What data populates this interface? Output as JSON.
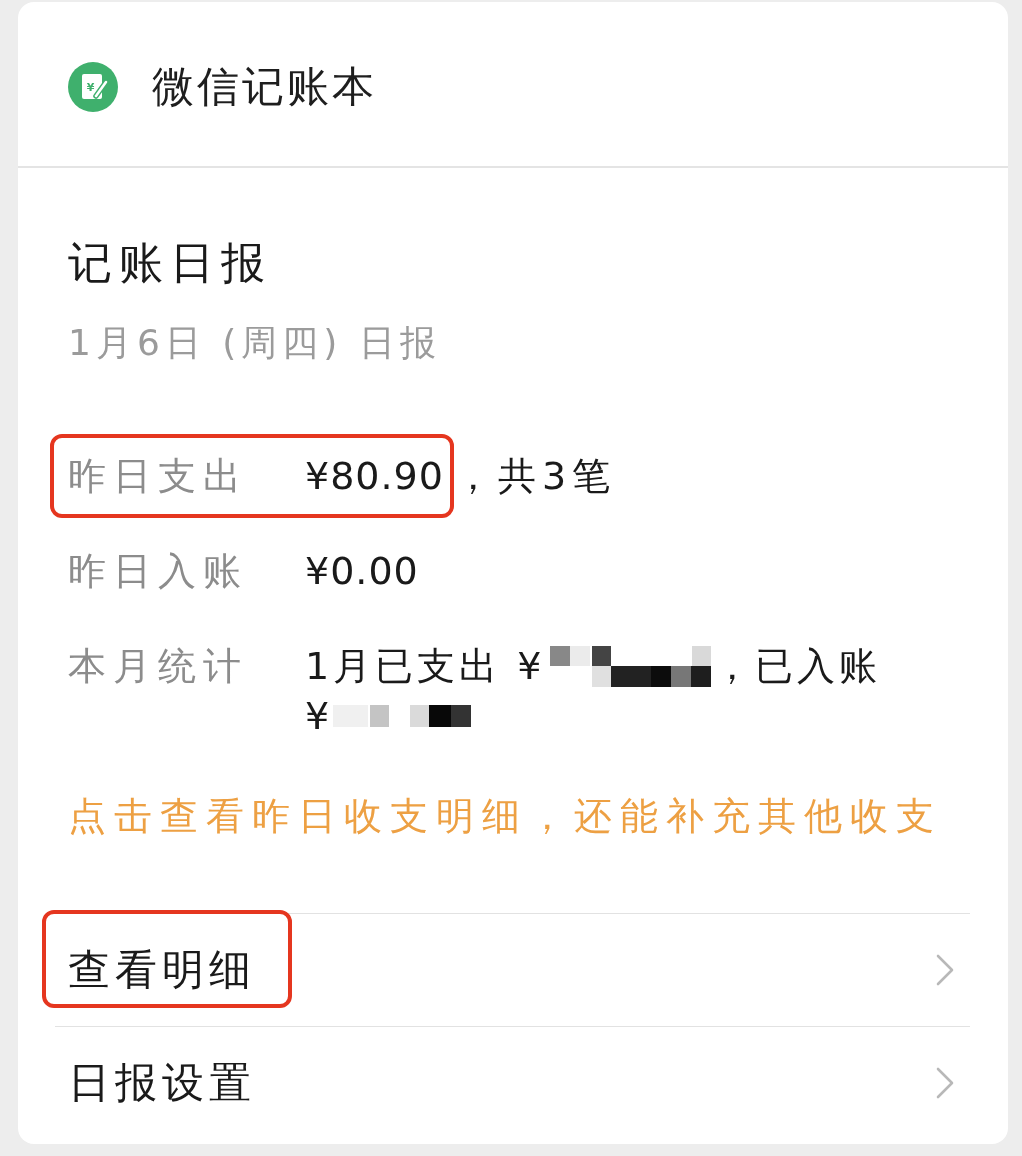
{
  "header": {
    "logo_glyph": "¥",
    "title": "微信记账本"
  },
  "report": {
    "title": "记账日报",
    "subtitle": "1月6日 (周四) 日报",
    "stats": [
      {
        "kind": "amount",
        "label": "昨日支出",
        "value": "¥80.90",
        "note": "，共3笔",
        "highlighted": true
      },
      {
        "kind": "amount",
        "label": "昨日入账",
        "value": "¥0.00",
        "highlighted": false
      },
      {
        "kind": "summary",
        "label": "本月统计",
        "lines": [
          [
            {
              "kind": "text",
              "text": "1月已支出 ¥"
            },
            {
              "kind": "mosaic"
            },
            {
              "kind": "text",
              "text": "，已入账"
            }
          ],
          [
            {
              "kind": "text",
              "text": "¥"
            },
            {
              "kind": "mosaic"
            }
          ]
        ],
        "highlighted": false
      }
    ],
    "hint": "点击查看昨日收支明细，还能补充其他收支"
  },
  "menu": [
    {
      "label": "查看明细",
      "highlighted": true
    },
    {
      "label": "日报设置",
      "highlighted": false
    }
  ]
}
